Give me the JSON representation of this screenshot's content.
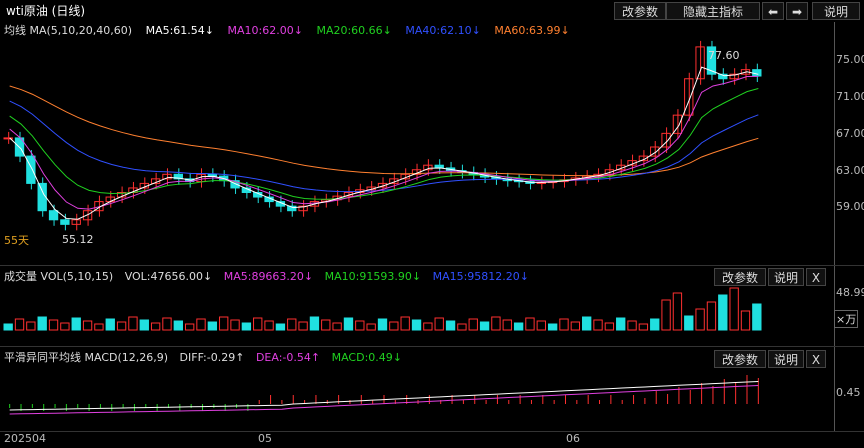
{
  "window": {
    "title": "wti原油 (日线)"
  },
  "toolbar": {
    "params": "改参数",
    "hide": "隐藏主指标",
    "left": "⬅",
    "right": "➡",
    "help": "说明"
  },
  "ma": {
    "label": "均线 MA(5,10,20,40,60)",
    "ma5": "MA5:61.54↓",
    "ma10": "MA10:62.00↓",
    "ma20": "MA20:60.66↓",
    "ma40": "MA40:62.10↓",
    "ma60": "MA60:63.99↓",
    "colors": {
      "ma5": "#ffffff",
      "ma10": "#e040e0",
      "ma20": "#20d020",
      "ma40": "#3050ff",
      "ma60": "#ff8030"
    }
  },
  "price": {
    "high": "77.60",
    "low": "55.12",
    "days": "55天",
    "ticks": [
      "75.00",
      "71.00",
      "67.00",
      "63.00",
      "59.00"
    ]
  },
  "volume": {
    "label": "成交量 VOL(5,10,15)",
    "vol": "VOL:47656.00↓",
    "ma5": "MA5:89663.20↓",
    "ma10": "MA10:91593.90↓",
    "ma15": "MA15:95812.20↓",
    "params": "改参数",
    "help": "说明",
    "close": "X",
    "tick": "48.99",
    "unit": "×万"
  },
  "macd": {
    "label": "平滑异同平均线 MACD(12,26,9)",
    "diff": "DIFF:-0.29↑",
    "dea": "DEA:-0.54↑",
    "macd": "MACD:0.49↓",
    "params": "改参数",
    "help": "说明",
    "close": "X",
    "tick": "0.45"
  },
  "xaxis": [
    "202504",
    "05",
    "06"
  ],
  "colors": {
    "up": "#ff3030",
    "down": "#20e0e0",
    "bg": "#000000"
  }
}
